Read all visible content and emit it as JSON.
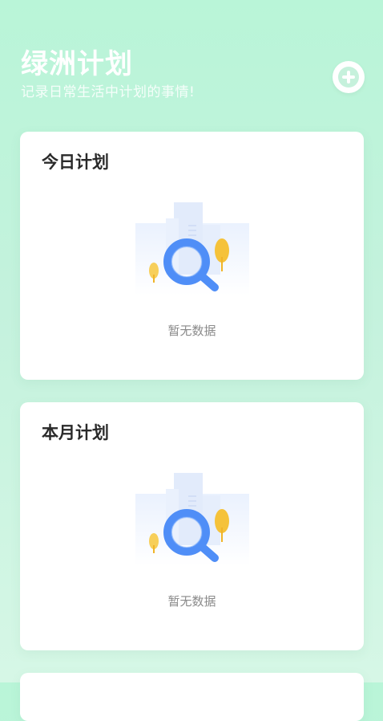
{
  "header": {
    "title": "绿洲计划",
    "subtitle": "记录日常生活中计划的事情!",
    "add_icon": "plus-circle-icon"
  },
  "cards": [
    {
      "title": "今日计划",
      "empty_text": "暂无数据",
      "illustration": "empty-search-illustration"
    },
    {
      "title": "本月计划",
      "empty_text": "暂无数据",
      "illustration": "empty-search-illustration"
    }
  ],
  "colors": {
    "background_top": "#b9f5d8",
    "background_bottom": "#d6f7e6",
    "card": "#ffffff",
    "accent_blue": "#4f8ef7",
    "accent_yellow": "#f5c23a",
    "title_text": "#2a2a2a",
    "muted_text": "#8a8a8a"
  }
}
